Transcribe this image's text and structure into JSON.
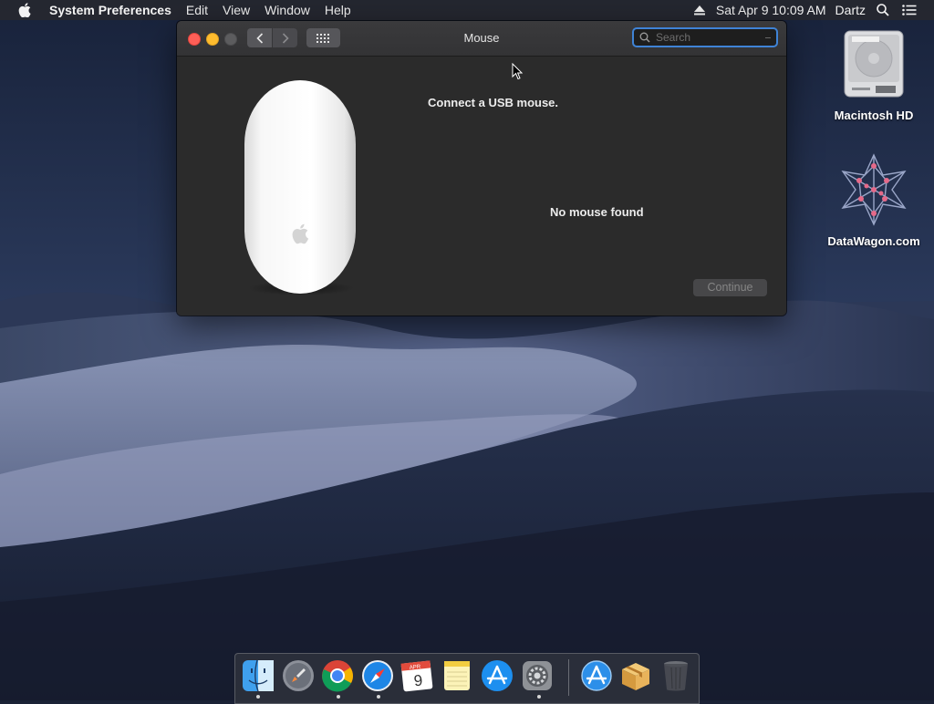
{
  "menubar": {
    "apple_icon": "apple-logo-icon",
    "app_name": "System Preferences",
    "menus": [
      "Edit",
      "View",
      "Window",
      "Help"
    ],
    "datetime": "Sat Apr 9  10:09 AM",
    "user": "Dartz"
  },
  "window": {
    "title": "Mouse",
    "search_placeholder": "Search",
    "search_value": "",
    "connect_message": "Connect a USB mouse.",
    "status_message": "No mouse found",
    "continue_label": "Continue"
  },
  "desktop": {
    "icons": [
      {
        "label": "Macintosh HD",
        "icon": "hard-drive-icon"
      },
      {
        "label": "DataWagon.com",
        "icon": "network-star-icon"
      }
    ]
  },
  "calendar_tile": {
    "month": "APR",
    "day": "9"
  },
  "dock": {
    "apps": [
      {
        "name": "Finder",
        "icon": "finder-icon",
        "running": true
      },
      {
        "name": "Launchpad",
        "icon": "launchpad-icon",
        "running": false
      },
      {
        "name": "Google Chrome",
        "icon": "chrome-icon",
        "running": true
      },
      {
        "name": "Safari",
        "icon": "safari-icon",
        "running": true
      },
      {
        "name": "Calendar",
        "icon": "calendar-icon",
        "running": false
      },
      {
        "name": "Notes",
        "icon": "notes-icon",
        "running": false
      },
      {
        "name": "App Store",
        "icon": "app-store-icon",
        "running": false
      },
      {
        "name": "System Preferences",
        "icon": "system-preferences-icon",
        "running": true
      },
      {
        "name": "Applications",
        "icon": "applications-folder-icon",
        "running": false
      },
      {
        "name": "Installer",
        "icon": "package-icon",
        "running": false
      },
      {
        "name": "Trash",
        "icon": "trash-icon",
        "running": false
      }
    ]
  },
  "colors": {
    "close": "#fd5f57",
    "minimize": "#febc2e",
    "search_focus": "#3f83d6",
    "window_bg": "#2b2b2b"
  }
}
